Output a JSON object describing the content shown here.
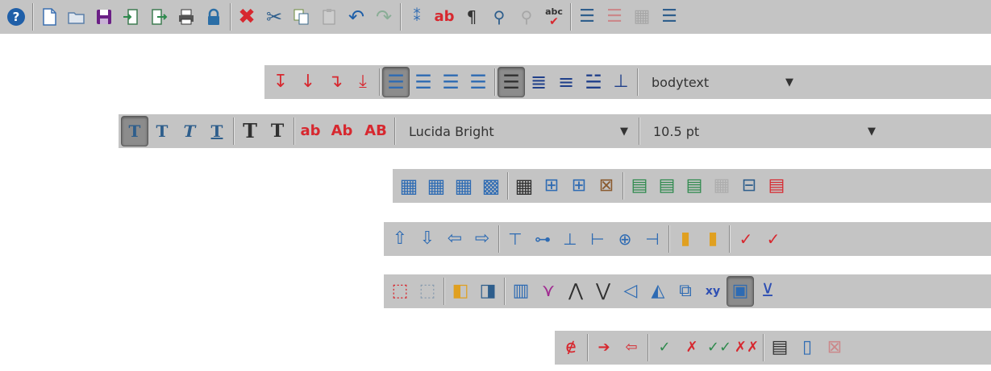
{
  "colors": {
    "toolbar_bg": "#c4c4c4",
    "accent_red": "#d7282f",
    "accent_blue": "#2e6bb3"
  },
  "format_toolbar": {
    "case_lower_label": "ab",
    "case_title_label": "Ab",
    "case_upper_label": "AB",
    "font_name": "Lucida Bright",
    "font_size": "10.5 pt"
  },
  "paragraph_toolbar": {
    "style_name": "bodytext"
  },
  "main_toolbar": {
    "replace_label": "ab",
    "spellcheck_label": "abc"
  }
}
